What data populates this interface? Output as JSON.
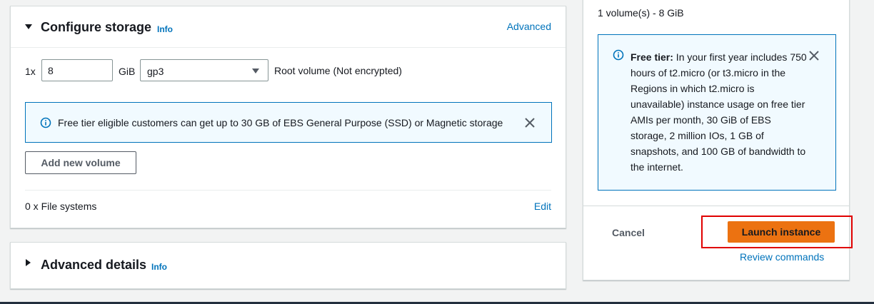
{
  "storage": {
    "title": "Configure storage",
    "info_label": "Info",
    "advanced_label": "Advanced",
    "volume": {
      "count": "1x",
      "size": "8",
      "unit": "GiB",
      "type": "gp3",
      "description": "Root volume  (Not encrypted)"
    },
    "alert_text": "Free tier eligible customers can get up to 30 GB of EBS General Purpose (SSD) or Magnetic storage",
    "add_volume_label": "Add new volume",
    "file_systems_label": "0 x File systems",
    "edit_label": "Edit"
  },
  "advanced_details": {
    "title": "Advanced details",
    "info_label": "Info"
  },
  "summary": {
    "volume_summary": "1 volume(s) - 8 GiB",
    "free_tier": {
      "label": "Free tier:",
      "text": " In your first year includes 750 hours of t2.micro (or t3.micro in the Regions in which t2.micro is unavailable) instance usage on free tier AMIs per month, 30 GiB of EBS storage, 2 million IOs, 1 GB of snapshots, and 100 GB of bandwidth to the internet."
    },
    "cancel_label": "Cancel",
    "launch_label": "Launch instance",
    "review_label": "Review commands"
  },
  "colors": {
    "link": "#0073bb",
    "primary_button": "#ec7211",
    "alert_background": "#f1faff",
    "highlight": "#e00000"
  },
  "icons": {
    "info": "info-circle-icon",
    "close": "close-icon",
    "expand": "caret-down-icon",
    "collapse": "caret-right-icon",
    "dropdown": "dropdown-arrow-icon"
  }
}
